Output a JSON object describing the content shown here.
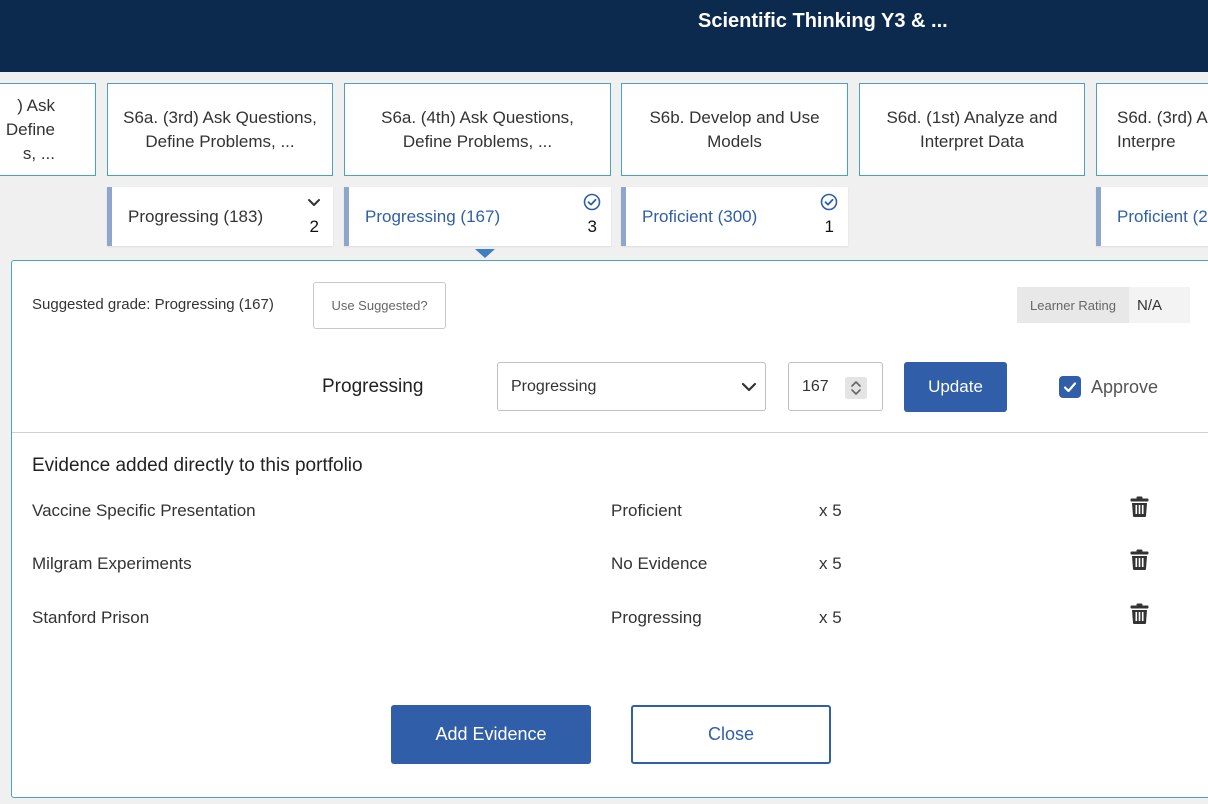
{
  "header": {
    "title": "Scientific Thinking Y3 & ..."
  },
  "standards": [
    {
      "title_lines": [
        ") Ask",
        "Define",
        "s, ..."
      ]
    },
    {
      "title_lines": [
        "S6a. (3rd) Ask Questions,",
        "Define Problems, ..."
      ]
    },
    {
      "title_lines": [
        "S6a. (4th) Ask Questions,",
        "Define Problems, ..."
      ]
    },
    {
      "title_lines": [
        "S6b. Develop and Use",
        "Models"
      ]
    },
    {
      "title_lines": [
        "S6d. (1st) Analyze and",
        "Interpret Data"
      ]
    },
    {
      "title_lines": [
        "S6d. (3rd) A",
        "Interpre"
      ]
    }
  ],
  "grade_chips": [
    {
      "label": "Progressing (183)",
      "count": "2",
      "icon": "chevron-down-icon"
    },
    {
      "label": "Progressing (167)",
      "count": "3",
      "icon": "check-circle-icon"
    },
    {
      "label": "Proficient (300)",
      "count": "1",
      "icon": "check-circle-icon"
    },
    {
      "label": "Proficient (2"
    }
  ],
  "panel": {
    "suggested_text": "Suggested grade: Progressing (167)",
    "use_suggested_label": "Use Suggested?",
    "learner_rating_label": "Learner Rating",
    "learner_rating_value": "N/A",
    "grade_name": "Progressing",
    "grade_select_value": "Progressing",
    "score_value": "167",
    "update_label": "Update",
    "approve_label": "Approve",
    "approve_checked": true
  },
  "evidence": {
    "heading": "Evidence added directly to this portfolio",
    "items": [
      {
        "name": "Vaccine Specific Presentation",
        "grade": "Proficient",
        "weight": "x 5"
      },
      {
        "name": "Milgram Experiments",
        "grade": "No Evidence",
        "weight": "x 5"
      },
      {
        "name": "Stanford Prison",
        "grade": "Progressing",
        "weight": "x 5"
      }
    ]
  },
  "actions": {
    "add_label": "Add Evidence",
    "close_label": "Close"
  },
  "colors": {
    "header_bg": "#0b2a4e",
    "primary": "#305ea8",
    "card_border": "#4aa3b8",
    "chip_accent": "#8ea6cc"
  }
}
